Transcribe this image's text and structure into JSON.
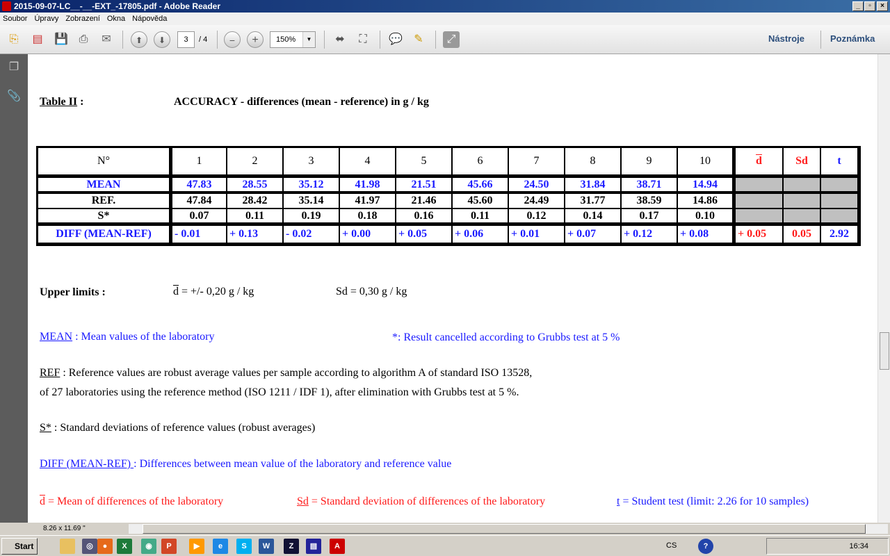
{
  "window": {
    "title": "2015-09-07-LC__-__-EXT_-17805.pdf - Adobe Reader",
    "controls": [
      "_",
      "▫",
      "×"
    ]
  },
  "menu": [
    "Soubor",
    "Úpravy",
    "Zobrazení",
    "Okna",
    "Nápověda"
  ],
  "toolbar": {
    "page_current": "3",
    "page_total": "/ 4",
    "zoom": "150%",
    "tools_label": "Nástroje",
    "comment_label": "Poznámka"
  },
  "status": {
    "page_size": "8.26 x 11.69 \""
  },
  "doc": {
    "table_label": "Table II",
    "table_colon": ":",
    "table_title": "ACCURACY - differences (mean - reference) in g / kg",
    "table": {
      "header": [
        "N°",
        "1",
        "2",
        "3",
        "4",
        "5",
        "6",
        "7",
        "8",
        "9",
        "10",
        "d",
        "Sd",
        "t"
      ],
      "rows": [
        {
          "label": "MEAN",
          "values": [
            "47.83",
            "28.55",
            "35.12",
            "41.98",
            "21.51",
            "45.66",
            "24.50",
            "31.84",
            "38.71",
            "14.94"
          ]
        },
        {
          "label": "REF.",
          "values": [
            "47.84",
            "28.42",
            "35.14",
            "41.97",
            "21.46",
            "45.60",
            "24.49",
            "31.77",
            "38.59",
            "14.86"
          ]
        },
        {
          "label": "S*",
          "values": [
            "0.07",
            "0.11",
            "0.19",
            "0.18",
            "0.16",
            "0.11",
            "0.12",
            "0.14",
            "0.17",
            "0.10"
          ]
        },
        {
          "label": "DIFF (MEAN-REF)",
          "values": [
            "- 0.01",
            "+ 0.13",
            "- 0.02",
            "+ 0.00",
            "+ 0.05",
            "+ 0.06",
            "+ 0.01",
            "+ 0.07",
            "+ 0.12",
            "+ 0.08"
          ],
          "summary": [
            "+ 0.05",
            "0.05",
            "2.92"
          ]
        }
      ]
    },
    "upper_limits_label": "Upper limits :",
    "upper_d_sym": "d",
    "upper_d": " = +/- 0,20 g / kg",
    "upper_sd": "Sd =  0,30 g / kg",
    "mean_term": "MEAN",
    "mean_desc": " : Mean values of the laboratory",
    "grubbs_note": "*: Result cancelled according to Grubbs test at 5 %",
    "ref_term": "REF",
    "ref_desc1": " : Reference values are robust average values per sample according to algorithm A of standard ISO 13528,",
    "ref_desc2": "of  27 laboratories using the reference method (ISO 1211 / IDF 1), after  elimination with Grubbs test at 5 %.",
    "s_term": "S*",
    "s_desc": " : Standard deviations of reference values (robust averages)",
    "diff_term": "DIFF (MEAN-REF) ",
    "diff_desc": ": Differences between mean value of the laboratory and reference value",
    "d_term": "d",
    "d_desc": " = Mean of differences of the laboratory",
    "sd_term": "Sd",
    "sd_desc": " = Standard deviation of differences of the laboratory",
    "t_term": "t",
    "t_desc": " = Student test (limit: 2.26 for 10 samples)"
  },
  "taskbar": {
    "start": "Start",
    "lang": "CS",
    "clock": "16:34"
  },
  "colors": {
    "blue_text": "#1a1aff",
    "red_text": "#ff1a1a",
    "gray_cell": "#c0c0c0"
  }
}
